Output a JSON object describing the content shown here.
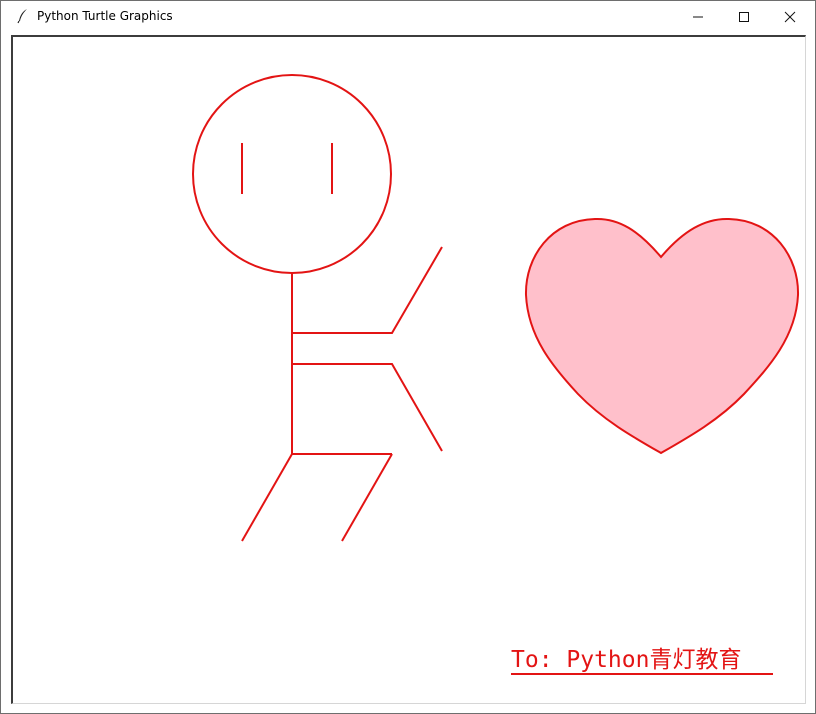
{
  "window": {
    "title": "Python Turtle Graphics",
    "icon": "feather-icon",
    "controls": [
      "minimize-icon",
      "maximize-icon",
      "close-icon"
    ]
  },
  "canvas": {
    "background": "#ffffff",
    "stroke_color": "#e31414",
    "heart_fill": "#ffc0cb",
    "caption": "To: Python青灯教育",
    "caption_color": "#e31414"
  }
}
